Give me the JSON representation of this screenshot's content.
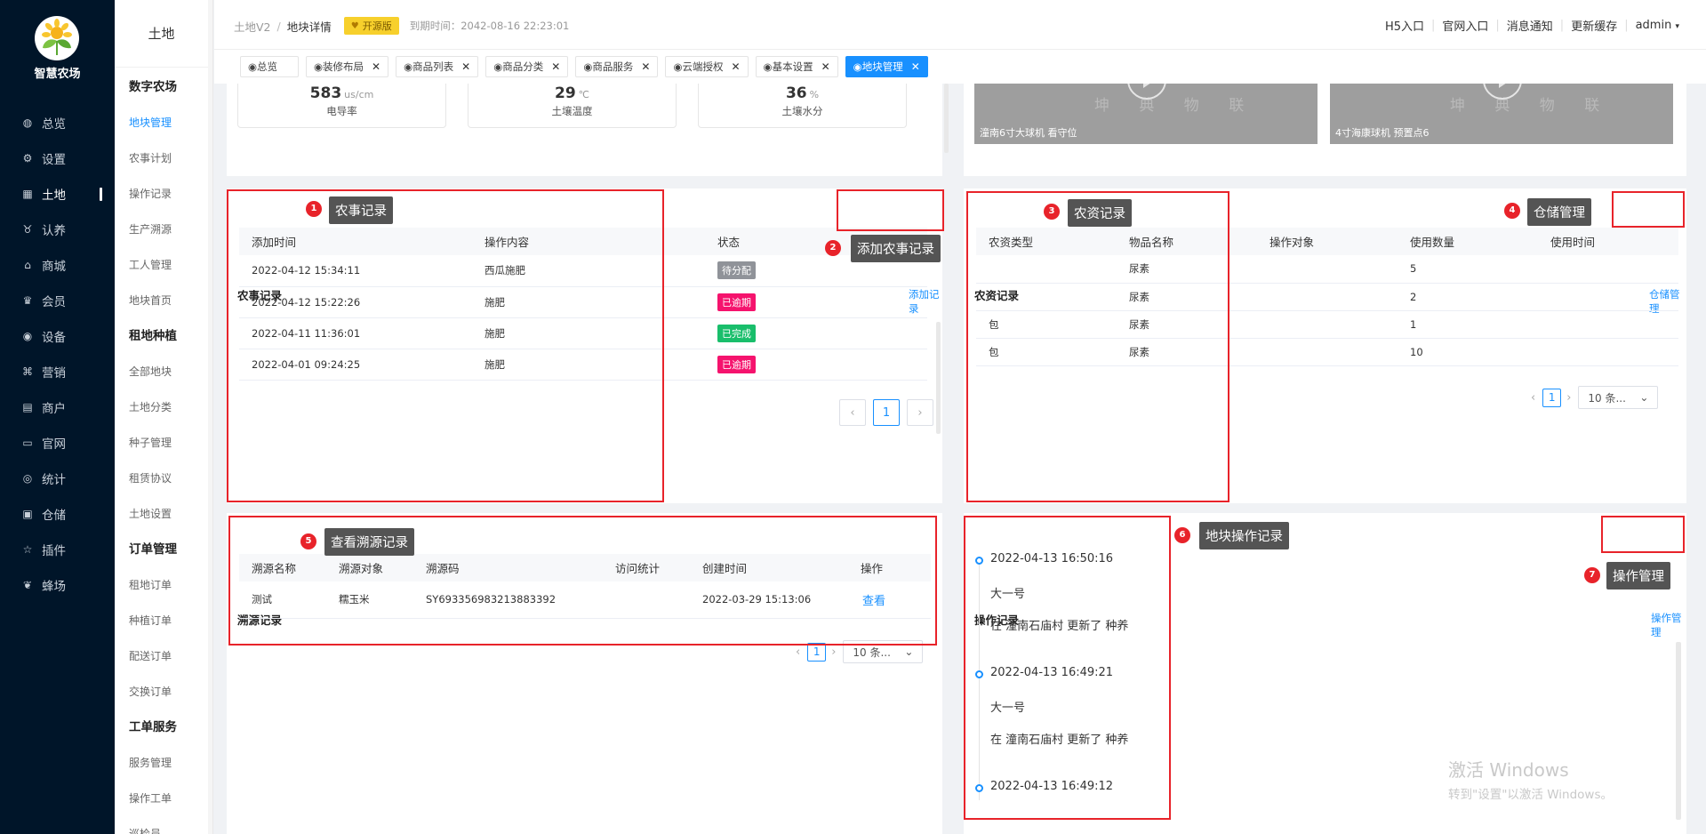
{
  "app": {
    "logo_name": "智慧农场"
  },
  "sidebar": {
    "items": [
      {
        "label": "总览",
        "icon": "dashboard-icon"
      },
      {
        "label": "设置",
        "icon": "gear-icon"
      },
      {
        "label": "土地",
        "icon": "grid-icon"
      },
      {
        "label": "认养",
        "icon": "adopt-icon"
      },
      {
        "label": "商城",
        "icon": "shop-icon"
      },
      {
        "label": "会员",
        "icon": "member-icon"
      },
      {
        "label": "设备",
        "icon": "device-icon"
      },
      {
        "label": "营销",
        "icon": "marketing-icon"
      },
      {
        "label": "商户",
        "icon": "merchant-icon"
      },
      {
        "label": "官网",
        "icon": "website-icon"
      },
      {
        "label": "统计",
        "icon": "stats-icon"
      },
      {
        "label": "仓储",
        "icon": "warehouse-icon"
      },
      {
        "label": "插件",
        "icon": "plugin-icon"
      },
      {
        "label": "蜂场",
        "icon": "bee-icon"
      }
    ]
  },
  "subnav": {
    "title": "土地",
    "groups": [
      {
        "title": "数字农场",
        "items": [
          "地块管理",
          "农事计划",
          "操作记录",
          "生产溯源",
          "工人管理",
          "地块首页"
        ]
      },
      {
        "title": "租地种植",
        "items": [
          "全部地块",
          "土地分类",
          "种子管理",
          "租赁协议",
          "土地设置"
        ]
      },
      {
        "title": "订单管理",
        "items": [
          "租地订单",
          "种植订单",
          "配送订单",
          "交换订单"
        ]
      },
      {
        "title": "工单服务",
        "items": [
          "服务管理",
          "操作工单",
          "巡检员"
        ]
      }
    ]
  },
  "header": {
    "crumb_parent": "土地V2",
    "crumb_sep": "/",
    "crumb_current": "地块详情",
    "badge": "开源版",
    "expire": "到期时间：2042-08-16 22:23:01",
    "links": [
      "H5入口",
      "官网入口",
      "消息通知",
      "更新缓存"
    ],
    "user": "admin"
  },
  "tabs": [
    "◉总览",
    "◉装修布局",
    "◉商品列表",
    "◉商品分类",
    "◉商品服务",
    "◉云端授权",
    "◉基本设置",
    "◉地块管理"
  ],
  "metrics": [
    {
      "value": "583",
      "unit": "us/cm",
      "label": "电导率"
    },
    {
      "value": "29",
      "unit": "℃",
      "label": "土壤温度"
    },
    {
      "value": "36",
      "unit": "%",
      "label": "土壤水分"
    }
  ],
  "videos": [
    {
      "caption": "潼南6寸大球机 看守位",
      "watermark": "坤 典 物 联"
    },
    {
      "caption": "4寸海康球机 预置点6",
      "watermark": "坤 典 物 联"
    }
  ],
  "farm_records": {
    "title": "农事记录",
    "add_link": "添加记录",
    "columns": [
      "添加时间",
      "操作内容",
      "状态"
    ],
    "rows": [
      {
        "time": "2022-04-12 15:34:11",
        "content": "西瓜施肥",
        "status": "待分配",
        "color": "#909399"
      },
      {
        "time": "2022-04-12 15:22:26",
        "content": "施肥",
        "status": "已逾期",
        "color": "#f5136d"
      },
      {
        "time": "2022-04-11 11:36:01",
        "content": "施肥",
        "status": "已完成",
        "color": "#19be6b"
      },
      {
        "time": "2022-04-01 09:24:25",
        "content": "施肥",
        "status": "已逾期",
        "color": "#f5136d"
      }
    ],
    "page": "1"
  },
  "input_records": {
    "title": "农资记录",
    "link": "仓储管理",
    "columns": [
      "农资类型",
      "物品名称",
      "操作对象",
      "使用数量",
      "使用时间"
    ],
    "rows": [
      {
        "type": "",
        "name": "尿素",
        "target": "",
        "qty": "5",
        "time": ""
      },
      {
        "type": "",
        "name": "尿素",
        "target": "",
        "qty": "2",
        "time": ""
      },
      {
        "type": "包",
        "name": "尿素",
        "target": "",
        "qty": "1",
        "time": ""
      },
      {
        "type": "包",
        "name": "尿素",
        "target": "",
        "qty": "10",
        "time": ""
      }
    ],
    "page": "1",
    "page_size": "10 条..."
  },
  "trace_records": {
    "title": "溯源记录",
    "columns": [
      "溯源名称",
      "溯源对象",
      "溯源码",
      "访问统计",
      "创建时间",
      "操作"
    ],
    "rows": [
      {
        "name": "测试",
        "target": "糯玉米",
        "code": "SY693356983213883392",
        "visits": "",
        "created": "2022-03-29 15:13:06",
        "action": "查看"
      }
    ],
    "page": "1",
    "page_size": "10 条..."
  },
  "operation_records": {
    "title": "操作记录",
    "link": "操作管理",
    "items": [
      {
        "time": "2022-04-13 16:50:16",
        "name": "大一号",
        "desc": "在 潼南石庙村 更新了 种养"
      },
      {
        "time": "2022-04-13 16:49:21",
        "name": "大一号",
        "desc": "在 潼南石庙村 更新了 种养"
      },
      {
        "time": "2022-04-13 16:49:12"
      }
    ]
  },
  "annotations": [
    {
      "num": "1",
      "label": "农事记录"
    },
    {
      "num": "2",
      "label": "添加农事记录"
    },
    {
      "num": "3",
      "label": "农资记录"
    },
    {
      "num": "4",
      "label": "仓储管理"
    },
    {
      "num": "5",
      "label": "查看溯源记录"
    },
    {
      "num": "6",
      "label": "地块操作记录"
    },
    {
      "num": "7",
      "label": "操作管理"
    }
  ],
  "watermark": {
    "line1": "激活 Windows",
    "line2": "转到\"设置\"以激活 Windows。"
  },
  "colors": {
    "sidebar_bg": "#001529",
    "accent": "#1890ff",
    "annotation_red": "#e8232a",
    "badge_yellow": "#f7d02c"
  }
}
